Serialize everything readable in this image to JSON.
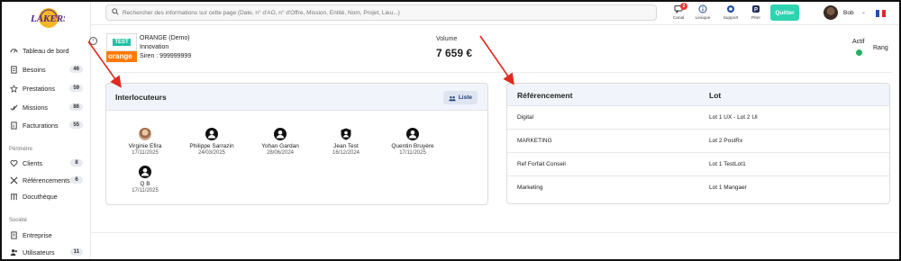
{
  "colors": {
    "accent": "#2ed3b1",
    "card_header_bg": "#f1f5fb",
    "badge_red": "#e53935",
    "active_green": "#27ae60",
    "annotation_arrow": "#e02a1f",
    "orange_brand": "#ff7900"
  },
  "sidebar": {
    "logo_icon": "lakers-logo",
    "items": [
      {
        "label": "Tableau de bord",
        "icon": "dashboard-icon",
        "badge": ""
      },
      {
        "label": "Besoins",
        "icon": "document-icon",
        "badge": "46"
      },
      {
        "label": "Prestations",
        "icon": "star-icon",
        "badge": "59"
      },
      {
        "label": "Missions",
        "icon": "check-icon",
        "badge": "86"
      },
      {
        "label": "Facturations",
        "icon": "invoice-icon",
        "badge": "55"
      }
    ],
    "section_perimetre": "Périmètre",
    "perimetre_items": [
      {
        "label": "Clients",
        "icon": "heart-icon",
        "badge": "8"
      },
      {
        "label": "Référencements",
        "icon": "cross-arrows-icon",
        "badge": "6"
      },
      {
        "label": "Docuthèque",
        "icon": "library-icon",
        "badge": ""
      }
    ],
    "section_societe": "Société",
    "societe_items": [
      {
        "label": "Entreprise",
        "icon": "building-icon",
        "badge": ""
      },
      {
        "label": "Utilisateurs",
        "icon": "users-icon",
        "badge": "11"
      }
    ]
  },
  "header": {
    "search_placeholder": "Rechercher des informations sur cette page (Date, n° d'AO, n° d'Offre, Mission, Entité, Nom, Projet, Lieu...)",
    "icons": [
      {
        "label": "Canal",
        "icon": "chat-icon",
        "badge": "2"
      },
      {
        "label": "Lexique",
        "icon": "info-icon",
        "badge": ""
      },
      {
        "label": "Support",
        "icon": "support-icon",
        "badge": ""
      },
      {
        "label": "Piter",
        "icon": "piter-icon",
        "badge": ""
      }
    ],
    "quit_label": "Quitter",
    "user_name": "Bob",
    "language_flag": "france-flag"
  },
  "entity": {
    "logo_text_top": "TEST",
    "logo_text_bottom": "orange",
    "name": "ORANGE (Demo)",
    "subtitle": "Innovation",
    "siren": "Siren : 999999999",
    "volume_label": "Volume",
    "volume_value": "7 659 €",
    "status_label": "Actif",
    "rang_label": "Rang"
  },
  "interlocuteurs": {
    "title": "Interlocuteurs",
    "list_button": "Liste",
    "contacts": [
      {
        "name": "Virginie Efira",
        "date": "17/11/2025",
        "avatar": "photo"
      },
      {
        "name": "Philippe Sarrazin",
        "date": "24/03/2025",
        "avatar": "user-icon"
      },
      {
        "name": "Yohan Gardan",
        "date": "28/06/2024",
        "avatar": "user-icon"
      },
      {
        "name": "Jean Test",
        "date": "16/12/2024",
        "avatar": "shield-user-icon"
      },
      {
        "name": "Quentin Bruyère",
        "date": "17/11/2025",
        "avatar": "user-icon"
      },
      {
        "name": "Q B",
        "date": "17/11/2025",
        "avatar": "user-icon"
      }
    ]
  },
  "referencement": {
    "col1": "Référencement",
    "col2": "Lot",
    "rows": [
      {
        "ref": "Digital",
        "lot": "Lot 1 UX - Lot 2 UI"
      },
      {
        "ref": "MARKETING",
        "lot": "Lot 2 PostRx"
      },
      {
        "ref": "Ref Forfait Conseil",
        "lot": "Lot 1 TestLot1"
      },
      {
        "ref": "Marketing",
        "lot": "Lot 1 Mangaer"
      }
    ]
  }
}
